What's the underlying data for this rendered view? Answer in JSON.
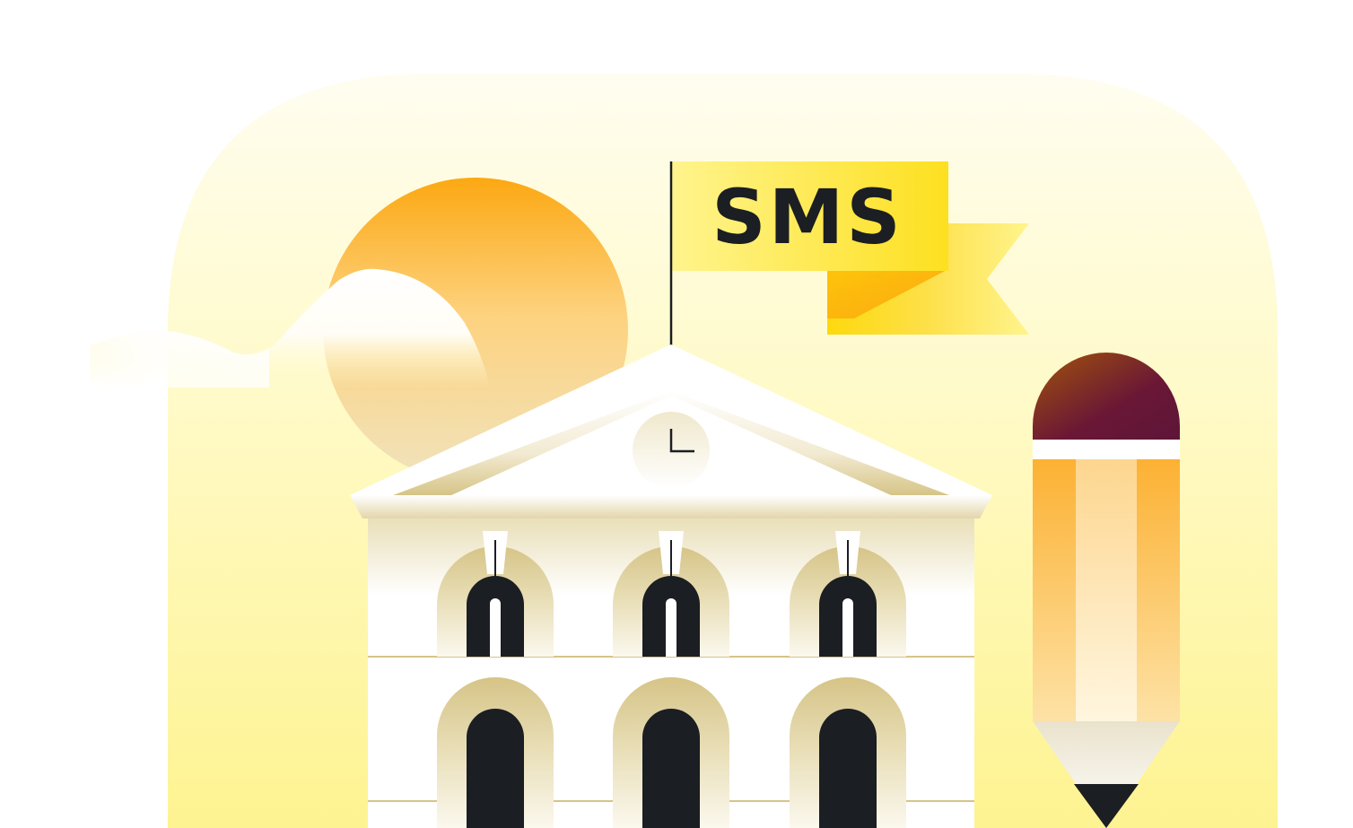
{
  "flag": {
    "label": "SMS"
  },
  "colors": {
    "background_arch": "#fef7a8",
    "sun": "#fca812",
    "flag_yellow": "#fde35a",
    "building": "#ffffff",
    "building_shade": "#d6c487",
    "window_dark": "#1b1e22",
    "pencil_body": "#fcb133",
    "pencil_eraser": "#6a1736"
  },
  "icons": [
    "sun-icon",
    "cloud-icon",
    "flag-icon",
    "building-icon",
    "clock-icon",
    "pencil-icon"
  ]
}
